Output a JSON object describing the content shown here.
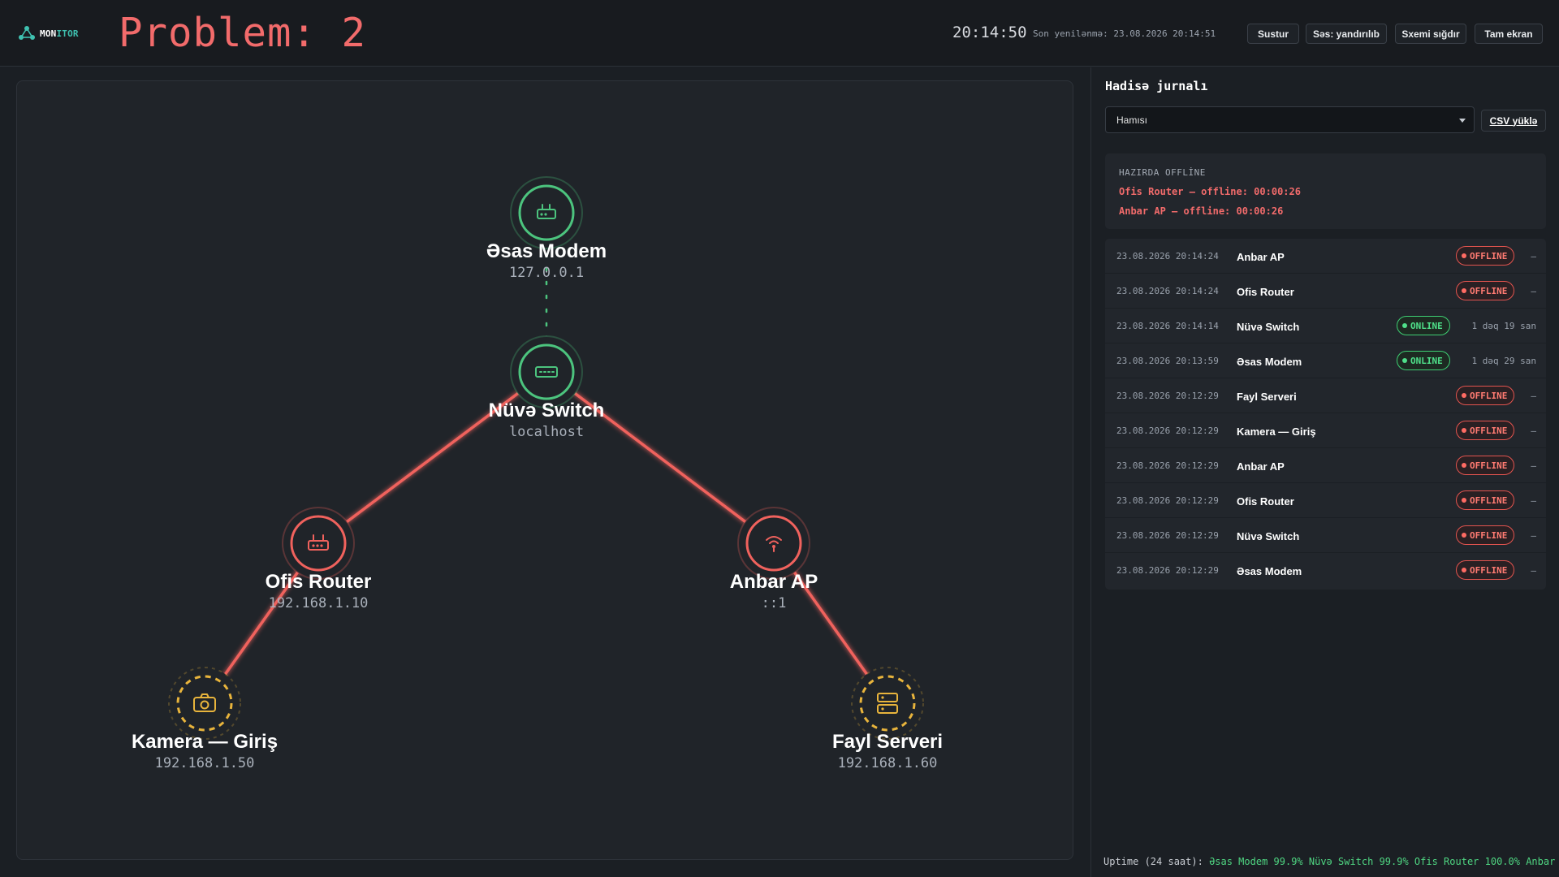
{
  "header": {
    "logo_text_a": "MON",
    "logo_text_b": "ITOR",
    "problem_text": "Problem: 2",
    "clock": "20:14:50",
    "last_refresh": "Son yenilənmə: 23.08.2026 20:14:51",
    "buttons": {
      "mute": "Sustur",
      "sound": "Səs: yandırılıb",
      "fit": "Sxemi sığdır",
      "fullscreen": "Tam ekran"
    }
  },
  "topology": {
    "nodes": [
      {
        "id": "modem",
        "name": "Əsas Modem",
        "ip": "127.0.0.1",
        "status": "online",
        "icon": "modem-icon"
      },
      {
        "id": "switch",
        "name": "Nüvə Switch",
        "ip": "localhost",
        "status": "online",
        "icon": "switch-icon"
      },
      {
        "id": "router",
        "name": "Ofis Router",
        "ip": "192.168.1.10",
        "status": "offline",
        "icon": "router-icon"
      },
      {
        "id": "ap",
        "name": "Anbar AP",
        "ip": "::1",
        "status": "offline",
        "icon": "wifi-icon"
      },
      {
        "id": "camera",
        "name": "Kamera — Giriş",
        "ip": "192.168.1.50",
        "status": "unknown",
        "icon": "camera-icon"
      },
      {
        "id": "server",
        "name": "Fayl Serveri",
        "ip": "192.168.1.60",
        "status": "unknown",
        "icon": "server-icon"
      }
    ],
    "links": [
      {
        "from": "modem",
        "to": "switch",
        "status": "online"
      },
      {
        "from": "switch",
        "to": "router",
        "status": "offline"
      },
      {
        "from": "switch",
        "to": "ap",
        "status": "offline"
      },
      {
        "from": "router",
        "to": "camera",
        "status": "offline"
      },
      {
        "from": "ap",
        "to": "server",
        "status": "offline"
      }
    ]
  },
  "panel": {
    "title": "Hadisə jurnalı",
    "filter_value": "Hamısı",
    "csv_button": "CSV yüklə",
    "offline_heading": "HAZIRDA OFFLİNE",
    "offline_items": [
      "Ofis Router — offline: 00:00:26",
      "Anbar AP — offline: 00:00:26"
    ],
    "log": [
      {
        "time": "23.08.2026 20:14:24",
        "device": "Anbar AP",
        "status": "OFFLINE",
        "duration": "–"
      },
      {
        "time": "23.08.2026 20:14:24",
        "device": "Ofis Router",
        "status": "OFFLINE",
        "duration": "–"
      },
      {
        "time": "23.08.2026 20:14:14",
        "device": "Nüvə Switch",
        "status": "ONLINE",
        "duration": "1 dəq 19 san"
      },
      {
        "time": "23.08.2026 20:13:59",
        "device": "Əsas Modem",
        "status": "ONLINE",
        "duration": "1 dəq 29 san"
      },
      {
        "time": "23.08.2026 20:12:29",
        "device": "Fayl Serveri",
        "status": "OFFLINE",
        "duration": "–"
      },
      {
        "time": "23.08.2026 20:12:29",
        "device": "Kamera — Giriş",
        "status": "OFFLINE",
        "duration": "–"
      },
      {
        "time": "23.08.2026 20:12:29",
        "device": "Anbar AP",
        "status": "OFFLINE",
        "duration": "–"
      },
      {
        "time": "23.08.2026 20:12:29",
        "device": "Ofis Router",
        "status": "OFFLINE",
        "duration": "–"
      },
      {
        "time": "23.08.2026 20:12:29",
        "device": "Nüvə Switch",
        "status": "OFFLINE",
        "duration": "–"
      },
      {
        "time": "23.08.2026 20:12:29",
        "device": "Əsas Modem",
        "status": "OFFLINE",
        "duration": "–"
      }
    ]
  },
  "uptime": {
    "label": "Uptime (24 saat):",
    "values": "Əsas Modem 99.9% Nüvə Switch 99.9% Ofis Router 100.0% Anbar"
  },
  "colors": {
    "online": "#4cc47e",
    "offline": "#f0625d",
    "unknown": "#e8b43c",
    "accent": "#3fc1b0"
  }
}
